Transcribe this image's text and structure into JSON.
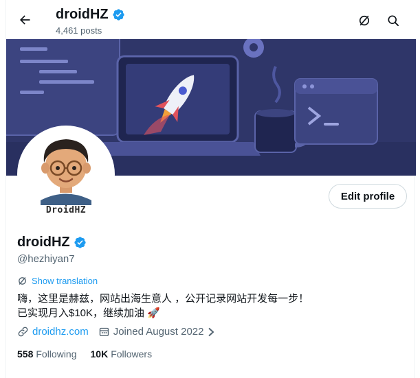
{
  "header": {
    "name": "droidHZ",
    "posts": "4,461 posts",
    "back_icon": "arrow-left-icon",
    "translate_icon": "translate-icon",
    "search_icon": "search-icon"
  },
  "profile": {
    "avatar_text": "DroidHZ",
    "edit_label": "Edit profile",
    "name": "droidHZ",
    "handle": "@hezhiyan7",
    "show_translation": "Show translation",
    "bio_line1": "嗨，这里是赫兹，网站出海生意人 ，公开记录网站开发每一步！",
    "bio_line2": "已实现月入$10K，继续加油 🚀",
    "website": "droidhz.com",
    "joined": "Joined August 2022",
    "following_count": "558",
    "following_label": "Following",
    "followers_count": "10K",
    "followers_label": "Followers"
  },
  "colors": {
    "accent": "#1d9bf0",
    "banner": "#2e3567",
    "muted": "#536471"
  }
}
